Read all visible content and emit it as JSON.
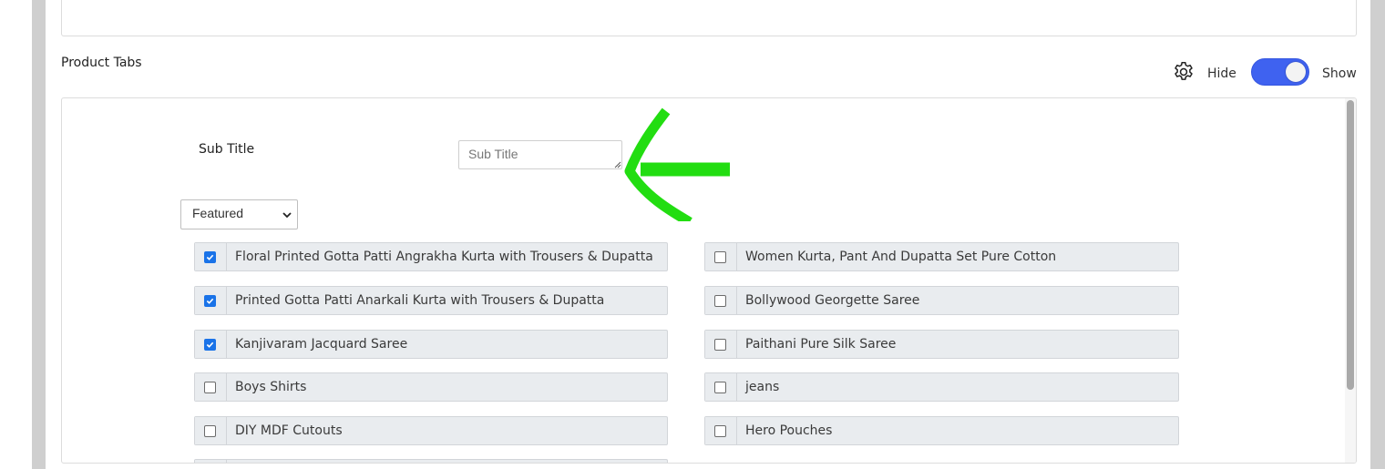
{
  "section": {
    "title": "Product Tabs"
  },
  "visibility": {
    "hide_label": "Hide",
    "show_label": "Show",
    "enabled": true
  },
  "subtitle": {
    "label": "Sub Title",
    "placeholder": "Sub Title",
    "value": ""
  },
  "filter": {
    "selected": "Featured"
  },
  "products": {
    "left": [
      {
        "label": "Floral Printed Gotta Patti Angrakha Kurta with Trousers & Dupatta",
        "checked": true
      },
      {
        "label": "Printed Gotta Patti Anarkali Kurta with Trousers & Dupatta",
        "checked": true
      },
      {
        "label": "Kanjivaram Jacquard Saree",
        "checked": true
      },
      {
        "label": "Boys Shirts",
        "checked": false
      },
      {
        "label": "DIY MDF Cutouts",
        "checked": false
      },
      {
        "label": "",
        "checked": false
      }
    ],
    "right": [
      {
        "label": "Women Kurta, Pant And Dupatta Set Pure Cotton",
        "checked": false
      },
      {
        "label": "Bollywood Georgette Saree",
        "checked": false
      },
      {
        "label": "Paithani Pure Silk Saree",
        "checked": false
      },
      {
        "label": "jeans",
        "checked": false
      },
      {
        "label": "Hero Pouches",
        "checked": false
      }
    ]
  },
  "colors": {
    "accent": "#3f62f0",
    "checkbox": "#1a73e8",
    "annotation": "#22dd11",
    "item_bg": "#e9ecef"
  },
  "icons": {
    "settings": "gear-icon",
    "annotation": "arrow-left-icon"
  }
}
